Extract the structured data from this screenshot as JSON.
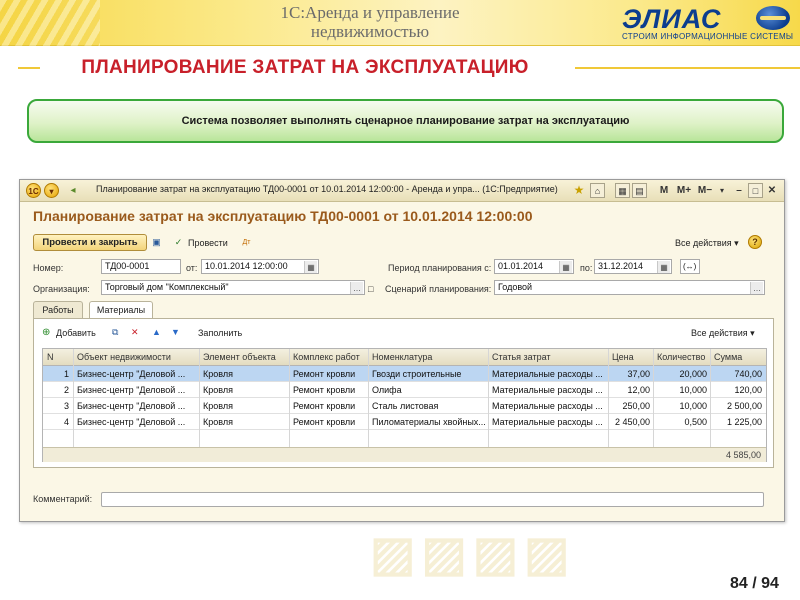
{
  "slide": {
    "title": "1С:Аренда и управление недвижимостью",
    "logo_text": "ЭЛИАС",
    "logo_subtitle": "СТРОИМ ИНФОРМАЦИОННЫЕ СИСТЕМЫ",
    "heading": "ПЛАНИРОВАНИЕ ЗАТРАТ НА ЭКСПЛУАТАЦИЮ",
    "banner_text": "Система позволяет выполнять сценарное планирование затрат на эксплуатацию",
    "page_number": "84 / 94",
    "accent_color": "#c8202a",
    "banner_border_color": "#3aa83a"
  },
  "window": {
    "titlebar_text": "Планирование затрат на эксплуатацию ТД00-0001 от 10.01.2014 12:00:00 - Аренда и упра...  (1С:Предприятие)",
    "titlebar_icons": [
      "1c-logo-icon",
      "dropdown-icon",
      "star-icon",
      "home-icon",
      "calendar-icon",
      "calculator-icon",
      "m-icon",
      "m-plus-icon",
      "m-minus-icon",
      "minimize-icon",
      "maximize-icon",
      "close-icon"
    ],
    "m_label": "M",
    "mplus_label": "M+",
    "mminus_label": "M−",
    "form_title": "Планирование затрат на эксплуатацию ТД00-0001 от 10.01.2014 12:00:00",
    "toolbar": {
      "post_close_label": "Провести и закрыть",
      "post_label": "Провести",
      "all_actions_label": "Все действия ▾",
      "help_label": "?"
    },
    "fields": {
      "number_label": "Номер:",
      "number_value": "ТД00-0001",
      "date_from_label": "от:",
      "date_from_value": "10.01.2014 12:00:00",
      "period_label": "Период планирования с:",
      "period_from_value": "01.01.2014",
      "period_to_label": "по:",
      "period_to_value": "31.12.2014",
      "org_label": "Организация:",
      "org_value": "Торговый дом \"Комплексный\"",
      "scenario_label": "Сценарий планирования:",
      "scenario_value": "Годовой",
      "comment_label": "Комментарий:",
      "comment_value": ""
    },
    "tabs": [
      {
        "label": "Работы",
        "active": false
      },
      {
        "label": "Материалы",
        "active": true
      }
    ],
    "table_toolbar": {
      "add_label": "Добавить",
      "fill_label": "Заполнить",
      "all_actions_label": "Все действия ▾"
    },
    "table": {
      "columns": [
        "N",
        "Объект недвижимости",
        "Элемент объекта",
        "Комплекс работ",
        "Номенклатура",
        "Статья затрат",
        "Цена",
        "Количество",
        "Сумма"
      ],
      "rows": [
        [
          "1",
          "Бизнес-центр \"Деловой ...",
          "Кровля",
          "Ремонт кровли",
          "Гвозди строительные",
          "Материальные расходы ...",
          "37,00",
          "20,000",
          "740,00"
        ],
        [
          "2",
          "Бизнес-центр \"Деловой ...",
          "Кровля",
          "Ремонт кровли",
          "Олифа",
          "Материальные расходы ...",
          "12,00",
          "10,000",
          "120,00"
        ],
        [
          "3",
          "Бизнес-центр \"Деловой ...",
          "Кровля",
          "Ремонт кровли",
          "Сталь листовая",
          "Материальные расходы ...",
          "250,00",
          "10,000",
          "2 500,00"
        ],
        [
          "4",
          "Бизнес-центр \"Деловой ...",
          "Кровля",
          "Ремонт кровли",
          "Пиломатериалы хвойных...",
          "Материальные расходы ...",
          "2 450,00",
          "0,500",
          "1 225,00"
        ]
      ],
      "selected_row": 0,
      "total": "4 585,00"
    }
  }
}
